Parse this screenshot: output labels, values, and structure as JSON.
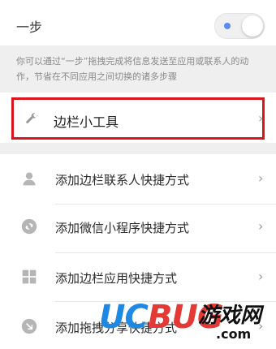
{
  "onestep": {
    "label": "一步",
    "toggle_on": true,
    "accent": "#5a8bf0"
  },
  "description": "你可以通过“一步”拖拽完成将信息发送至应用或联系人的动作，节省在不同应用之间切换的诸多步骤",
  "sidebar_tools": {
    "label": "边栏小工具",
    "icon": "wrench-icon",
    "highlight_color": "#d9141b"
  },
  "shortcuts": [
    {
      "label": "添加边栏联系人快捷方式",
      "icon": "person-icon"
    },
    {
      "label": "添加微信小程序快捷方式",
      "icon": "mini-program-icon"
    },
    {
      "label": "添加边栏应用快捷方式",
      "icon": "grid-apps-icon"
    },
    {
      "label": "添加拖拽分享快捷方式",
      "icon": "share-arrow-icon"
    }
  ],
  "watermark": {
    "brand_u": "U",
    "brand_c": "C",
    "brand_bug": "BUG",
    "site": "游戏网",
    "domain": ".com"
  }
}
